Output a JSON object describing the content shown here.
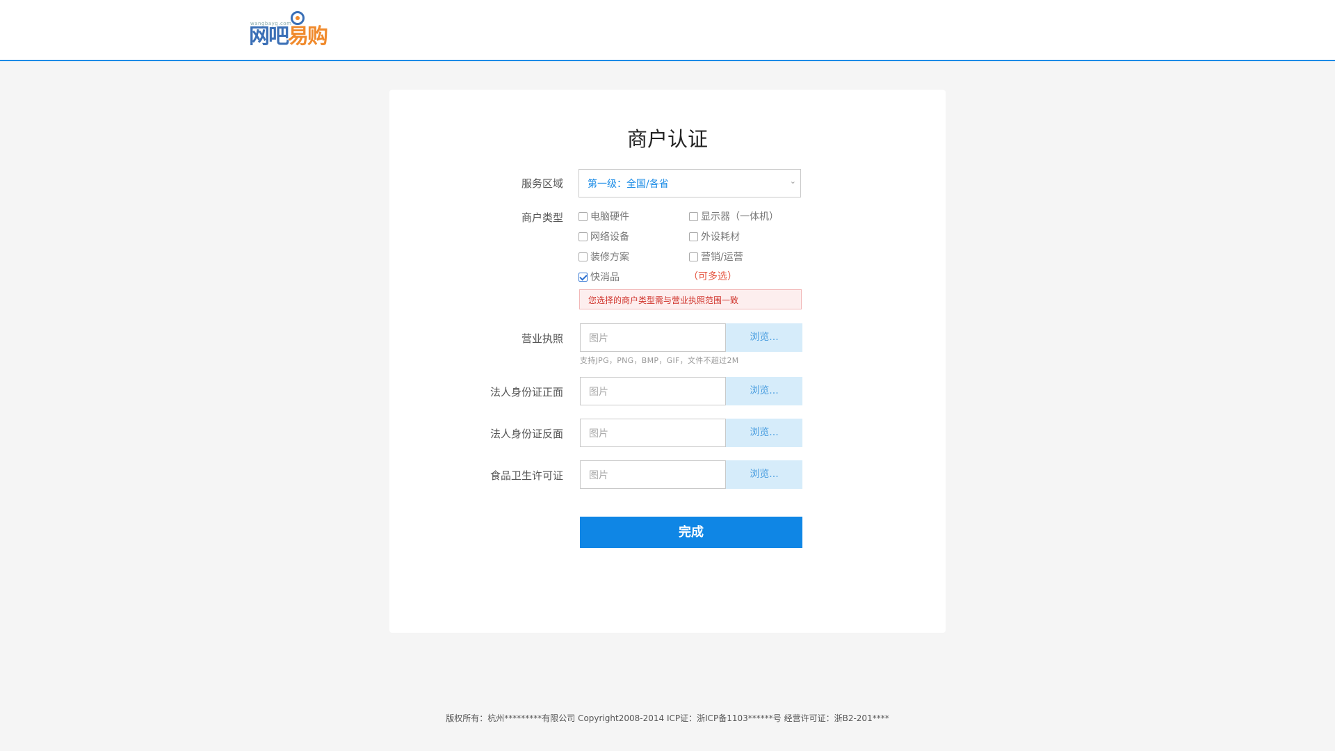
{
  "logo": {
    "domain_text": "wangbayg.com",
    "part1": "网吧",
    "part2": "易购"
  },
  "form": {
    "title": "商户认证",
    "service_area": {
      "label": "服务区域",
      "value": "第一级：全国/各省"
    },
    "merchant_type": {
      "label": "商户类型",
      "options": [
        {
          "label": "电脑硬件",
          "checked": false
        },
        {
          "label": "显示器（一体机）",
          "checked": false
        },
        {
          "label": "网络设备",
          "checked": false
        },
        {
          "label": "外设耗材",
          "checked": false
        },
        {
          "label": "装修方案",
          "checked": false
        },
        {
          "label": "营销/运营",
          "checked": false
        },
        {
          "label": "快消品",
          "checked": true
        }
      ],
      "multi_note": "（可多选）",
      "warning": "您选择的商户类型需与营业执照范围一致"
    },
    "uploads": [
      {
        "label": "营业执照",
        "placeholder": "图片",
        "button": "浏览..."
      },
      {
        "label": "法人身份证正面",
        "placeholder": "图片",
        "button": "浏览..."
      },
      {
        "label": "法人身份证反面",
        "placeholder": "图片",
        "button": "浏览..."
      },
      {
        "label": "食品卫生许可证",
        "placeholder": "图片",
        "button": "浏览..."
      }
    ],
    "upload_hint": "支持JPG，PNG，BMP，GIF，文件不超过2M",
    "submit": "完成"
  },
  "footer": {
    "text": "版权所有：杭州*********有限公司 Copyright2008-2014 ICP证：浙ICP备1103******号 经营许可证：浙B2-201****"
  },
  "colors": {
    "accent": "#0f86e5",
    "warning": "#d0342c",
    "note": "#e5533e"
  }
}
